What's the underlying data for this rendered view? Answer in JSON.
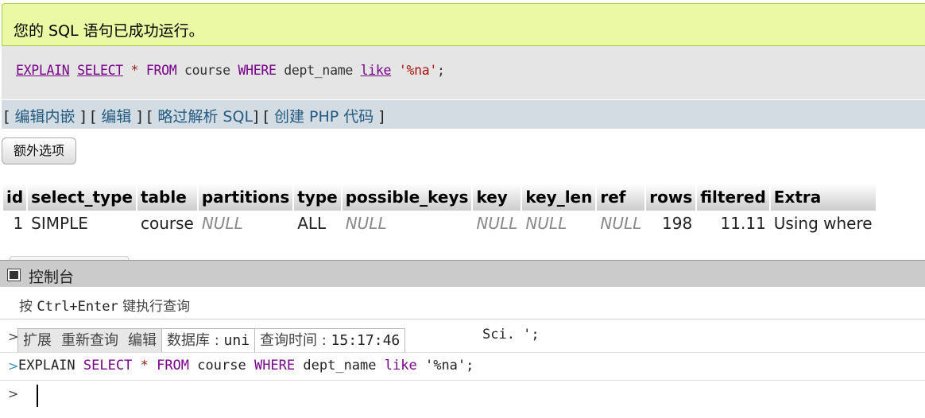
{
  "success_message": "您的 SQL 语句已成功运行。",
  "sql": {
    "explain": "EXPLAIN",
    "select": "SELECT",
    "star": "*",
    "from": "FROM",
    "table": "course",
    "where": "WHERE",
    "column": "dept_name",
    "like": "like",
    "string": "'%na'",
    "semicolon": ";"
  },
  "links": {
    "inline_edit": "编辑内嵌",
    "edit": "编辑",
    "skip_parse": "略过解析 SQL",
    "create_php": "创建 PHP 代码"
  },
  "extra_options_button": "额外选项",
  "result_table": {
    "columns": [
      "id",
      "select_type",
      "table",
      "partitions",
      "type",
      "possible_keys",
      "key",
      "key_len",
      "ref",
      "rows",
      "filtered",
      "Extra"
    ],
    "rows": [
      [
        "1",
        "SIMPLE",
        "course",
        "NULL",
        "ALL",
        "NULL",
        "NULL",
        "NULL",
        "NULL",
        "198",
        "11.11",
        "Using where"
      ]
    ]
  },
  "console": {
    "title": "控制台",
    "hint_prefix": "按 ",
    "hint_keys": "Ctrl+Enter",
    "hint_suffix": " 键执行查询",
    "options": {
      "expand": "扩展",
      "requery": "重新查询",
      "edit": "编辑",
      "database_label": "数据库 : ",
      "database_value": "uni",
      "time_label": "查询时间 : ",
      "time_value": "15:17:46"
    },
    "previous_tail": "Sci. ';",
    "last_query": {
      "explain": "EXPLAIN",
      "select": "SELECT",
      "star": "*",
      "from": "FROM",
      "table": "course",
      "where": "WHERE",
      "column": "dept_name",
      "like": "like",
      "string": "'%na'",
      "semicolon": ";"
    },
    "prompt_caret": ">"
  },
  "colors": {
    "success_bg": "#ebf8a4",
    "keyword": "#770088",
    "string": "#aa1111",
    "link": "#235a81"
  }
}
